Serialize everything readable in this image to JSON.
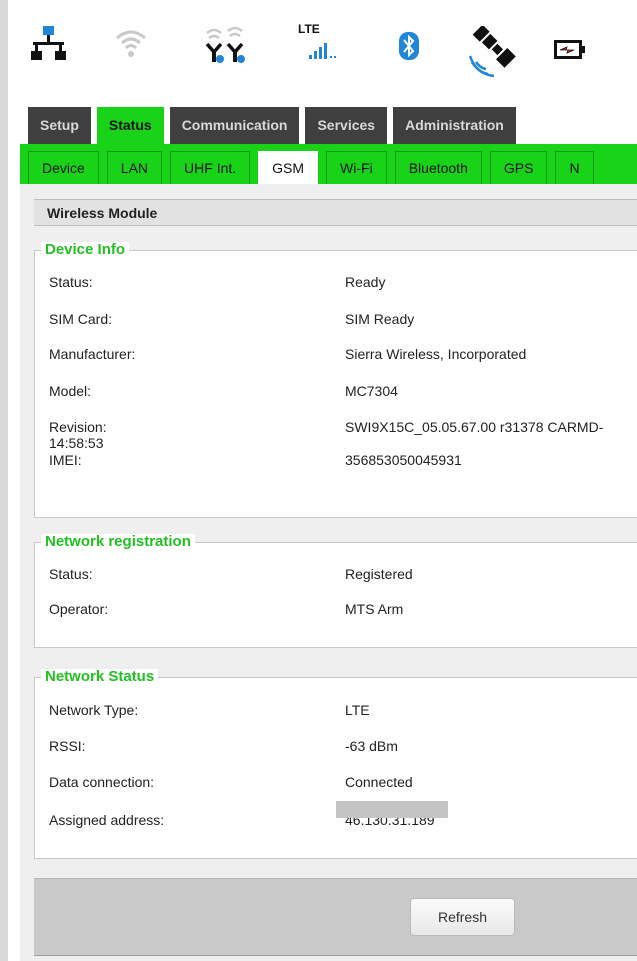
{
  "status_icons": [
    {
      "name": "network-icon"
    },
    {
      "name": "wifi-icon"
    },
    {
      "name": "uhf-antennas-icon"
    },
    {
      "name": "lte-signal-icon",
      "label": "LTE"
    },
    {
      "name": "bluetooth-icon"
    },
    {
      "name": "satellite-gps-icon"
    },
    {
      "name": "battery-charging-icon"
    }
  ],
  "main_tabs": [
    {
      "label": "Setup",
      "active": false
    },
    {
      "label": "Status",
      "active": true
    },
    {
      "label": "Communication",
      "active": false
    },
    {
      "label": "Services",
      "active": false
    },
    {
      "label": "Administration",
      "active": false
    }
  ],
  "sub_tabs": [
    {
      "label": "Device",
      "active": false
    },
    {
      "label": "LAN",
      "active": false
    },
    {
      "label": "UHF Int.",
      "active": false
    },
    {
      "label": "GSM",
      "active": true
    },
    {
      "label": "Wi-Fi",
      "active": false
    },
    {
      "label": "Bluetooth",
      "active": false
    },
    {
      "label": "GPS",
      "active": false
    },
    {
      "label": "N",
      "active": false
    }
  ],
  "section_title": "Wireless Module",
  "device_info": {
    "legend": "Device Info",
    "rows": [
      {
        "label": "Status:",
        "value": "Ready"
      },
      {
        "label": "SIM Card:",
        "value": "SIM Ready"
      },
      {
        "label": "Manufacturer:",
        "value": "Sierra Wireless, Incorporated"
      },
      {
        "label": "Model:",
        "value": "MC7304"
      },
      {
        "label": "Revision:",
        "label_wrap": "14:58:53",
        "value": "SWI9X15C_05.05.67.00 r31378 CARMD-"
      },
      {
        "label": "IMEI:",
        "value": "356853050045931"
      }
    ]
  },
  "network_registration": {
    "legend": "Network registration",
    "rows": [
      {
        "label": "Status:",
        "value": "Registered"
      },
      {
        "label": "Operator:",
        "value": "MTS Arm"
      }
    ]
  },
  "network_status": {
    "legend": "Network Status",
    "rows": [
      {
        "label": "Network Type:",
        "value": "LTE"
      },
      {
        "label": "RSSI:",
        "value": "-63 dBm"
      },
      {
        "label": "Data connection:",
        "value": "Connected"
      },
      {
        "label": "Assigned address:",
        "value": "46.130.31.189"
      }
    ]
  },
  "footer": {
    "refresh_label": "Refresh"
  },
  "colors": {
    "accent_green": "#19d319",
    "legend_green": "#22c022",
    "dark_tab": "#3f3f3f"
  }
}
